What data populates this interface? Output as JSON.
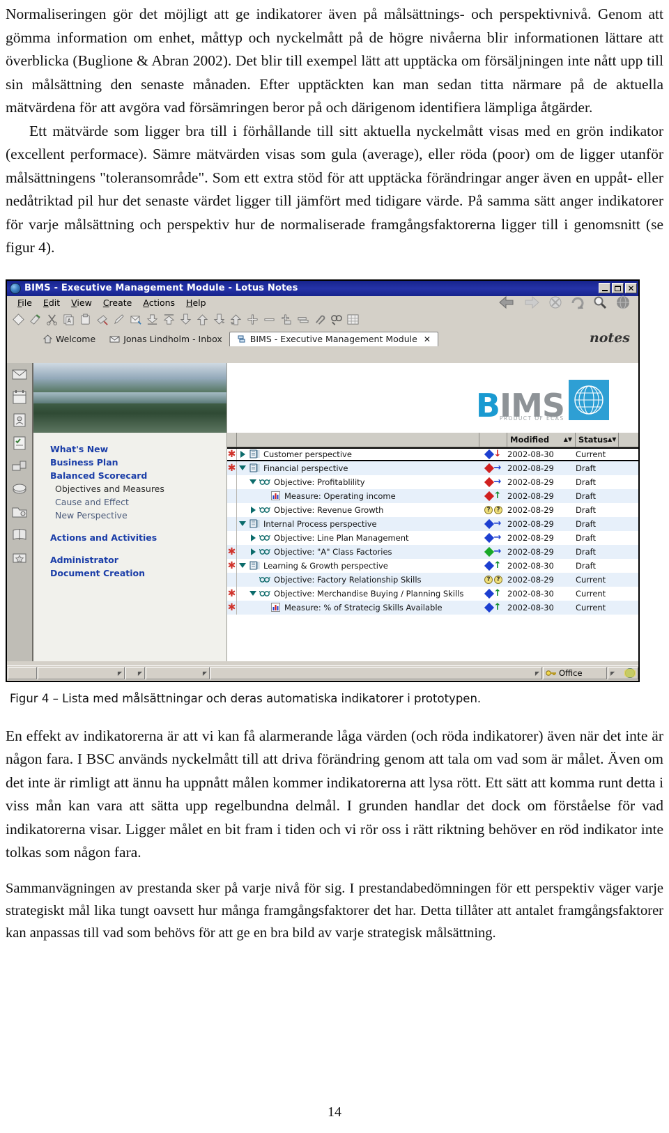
{
  "document": {
    "page_number": "14",
    "paragraph_1": "Normaliseringen gör det möjligt att ge indikatorer även på målsättnings- och perspektivnivå. Genom att gömma information om enhet, måttyp och nyckelmått på de högre nivåerna blir informationen lättare att överblicka (Buglione & Abran 2002). Det blir till exempel lätt att upptäcka om försäljningen inte nått upp till sin målsättning den senaste månaden. Efter upptäckten kan man sedan titta närmare på de aktuella mätvärdena för att avgöra vad försämringen beror på och därigenom identifiera lämpliga åtgärder.",
    "paragraph_2": "Ett mätvärde som ligger bra till i förhållande till sitt aktuella nyckelmått visas med en grön indikator (excellent performace). Sämre mätvärden visas som gula (average), eller röda (poor) om de ligger utanför målsättningens \"toleransområde\". Som ett extra stöd för att upptäcka förändringar anger även en uppåt- eller nedåtriktad pil hur det senaste värdet ligger till jämfört med tidigare värde. På samma sätt anger indikatorer för varje målsättning och perspektiv hur de normaliserade framgångsfaktorerna ligger till i genomsnitt (se figur 4).",
    "figure_caption": "Figur 4 – Lista med målsättningar och deras automatiska indikatorer i prototypen.",
    "paragraph_3": "En effekt av indikatorerna är att vi kan få alarmerande låga värden (och röda indikatorer) även när det inte är någon fara. I BSC används nyckelmått till att driva förändring genom att tala om vad som är målet. Även om det inte är rimligt att ännu ha uppnått målen kommer indikatorerna att lysa rött. Ett sätt att komma runt detta i viss mån kan vara att sätta upp regelbundna delmål. I grunden handlar det dock om förståelse för vad indikatorerna visar. Ligger målet en bit fram i tiden och vi rör oss i rätt riktning behöver en röd indikator inte tolkas som någon fara.",
    "paragraph_4": "Sammanvägningen av prestanda sker på varje nivå för sig. I prestandabedömningen för ett perspektiv väger varje strategiskt mål lika tungt oavsett hur många framgångsfaktorer det har. Detta tillåter att antalet framgångsfaktorer kan anpassas till vad som behövs för att ge en bra bild av varje strategisk målsättning."
  },
  "screenshot": {
    "window": {
      "title": "BIMS - Executive Management Module - Lotus Notes",
      "minimize_label": "Minimize",
      "maximize_label": "Maximize",
      "close_label": "Close"
    },
    "menubar": [
      {
        "label": "File",
        "mnemonic": "F"
      },
      {
        "label": "Edit",
        "mnemonic": "E"
      },
      {
        "label": "View",
        "mnemonic": "V"
      },
      {
        "label": "Create",
        "mnemonic": "C"
      },
      {
        "label": "Actions",
        "mnemonic": "A"
      },
      {
        "label": "Help",
        "mnemonic": "H"
      }
    ],
    "navigation_buttons": [
      {
        "name": "back-icon",
        "label": "Back"
      },
      {
        "name": "forward-icon",
        "label": "Forward"
      },
      {
        "name": "stop-icon",
        "label": "Stop"
      },
      {
        "name": "refresh-icon",
        "label": "Refresh"
      },
      {
        "name": "search-icon",
        "label": "Search"
      },
      {
        "name": "globe-icon",
        "label": "Open Web Page"
      }
    ],
    "toolbar_icons": [
      "new-document-icon",
      "edit-document-icon",
      "cut-icon",
      "copy-icon",
      "paste-icon",
      "delete-icon",
      "edit-pencil-icon",
      "send-mail-icon",
      "move-down-icon",
      "move-up-icon",
      "collapse-icon",
      "expand-icon",
      "collapse-all-icon",
      "expand-all-icon",
      "plus-icon",
      "minus-icon",
      "add-section-icon",
      "link-icon",
      "attach-icon",
      "find-icon",
      "table-icon"
    ],
    "tabs": [
      {
        "label": "Welcome",
        "icon": "home-icon",
        "active": false,
        "closable": false
      },
      {
        "label": "Jonas Lindholm - Inbox",
        "icon": "inbox-icon",
        "active": false,
        "closable": false
      },
      {
        "label": "BIMS - Executive Management Module",
        "icon": "module-icon",
        "active": true,
        "closable": true
      }
    ],
    "notes_wordmark": "notes",
    "icon_sidebar": [
      "mail-icon",
      "calendar-icon",
      "address-book-icon",
      "todo-icon",
      "replication-icon",
      "workspace-icon",
      "folder-icon",
      "bookmark-icon",
      "favorites-icon"
    ],
    "navigator": {
      "items": [
        {
          "label": "What's New",
          "style": "head"
        },
        {
          "label": "Business Plan",
          "style": "head"
        },
        {
          "label": "Balanced Scorecard",
          "style": "head"
        },
        {
          "label": "Objectives and Measures",
          "style": "sub"
        },
        {
          "label": "Cause and Effect",
          "style": "sub-dim"
        },
        {
          "label": "New Perspective",
          "style": "sub-dim"
        },
        {
          "label": "Actions and Activities",
          "style": "head"
        },
        {
          "label": "Administrator",
          "style": "head"
        },
        {
          "label": "Document Creation",
          "style": "head"
        }
      ]
    },
    "brand": {
      "logo_b": "B",
      "logo_rest": "IMS",
      "logo_tagline": "PRODUCT OF ECAS"
    },
    "list": {
      "columns": [
        {
          "key": "gutter",
          "label": "",
          "sortable": false
        },
        {
          "key": "name",
          "label": "",
          "sortable": false
        },
        {
          "key": "indicator",
          "label": "",
          "sortable": false
        },
        {
          "key": "modified",
          "label": "Modified",
          "sortable": true
        },
        {
          "key": "status",
          "label": "Status",
          "sortable": true
        }
      ],
      "rows": [
        {
          "indent": 0,
          "twisty": "right",
          "icon": "perspective-icon",
          "label": "Customer perspective",
          "mark": "",
          "ind_shape": "diamond",
          "ind_color": "#1d3fd0",
          "trend": "down",
          "trend_color": "#d02020",
          "modified": "2002-08-30",
          "status": "Current",
          "selected": true,
          "alt": false
        },
        {
          "indent": 0,
          "twisty": "down",
          "icon": "perspective-icon",
          "label": "Financial perspective",
          "mark": "",
          "ind_shape": "diamond",
          "ind_color": "#d02020",
          "trend": "right",
          "trend_color": "#1d3fd0",
          "modified": "2002-08-29",
          "status": "Draft",
          "selected": false,
          "alt": true
        },
        {
          "indent": 1,
          "twisty": "down",
          "icon": "objective-icon",
          "label": "Objective: Profitablility",
          "mark": "",
          "ind_shape": "diamond",
          "ind_color": "#d02020",
          "trend": "right",
          "trend_color": "#1d3fd0",
          "modified": "2002-08-29",
          "status": "Draft",
          "selected": false,
          "alt": false
        },
        {
          "indent": 2,
          "twisty": "none",
          "icon": "measure-icon",
          "label": "Measure: Operating income",
          "mark": "",
          "ind_shape": "diamond",
          "ind_color": "#d02020",
          "trend": "up",
          "trend_color": "#0a8a28",
          "modified": "2002-08-29",
          "status": "Draft",
          "selected": false,
          "alt": true
        },
        {
          "indent": 1,
          "twisty": "right",
          "icon": "objective-icon",
          "label": "Objective: Revenue Growth",
          "mark": "",
          "ind_shape": "question",
          "ind_color": "#e8d45a",
          "trend": "question",
          "trend_color": "#e8d45a",
          "modified": "2002-08-29",
          "status": "Draft",
          "selected": false,
          "alt": false
        },
        {
          "indent": 0,
          "twisty": "down",
          "icon": "perspective-icon",
          "label": "Internal Process perspective",
          "mark": "",
          "ind_shape": "diamond",
          "ind_color": "#1d3fd0",
          "trend": "right",
          "trend_color": "#1d3fd0",
          "modified": "2002-08-29",
          "status": "Draft",
          "selected": false,
          "alt": true
        },
        {
          "indent": 1,
          "twisty": "right",
          "icon": "objective-icon",
          "label": "Objective: Line Plan Management",
          "mark": "",
          "ind_shape": "diamond",
          "ind_color": "#1d3fd0",
          "trend": "right",
          "trend_color": "#1d3fd0",
          "modified": "2002-08-29",
          "status": "Draft",
          "selected": false,
          "alt": false
        },
        {
          "indent": 1,
          "twisty": "right",
          "icon": "objective-icon",
          "label": "Objective: \"A\" Class Factories",
          "mark": "*",
          "ind_shape": "diamond",
          "ind_color": "#18a828",
          "trend": "right",
          "trend_color": "#1d3fd0",
          "modified": "2002-08-29",
          "status": "Draft",
          "selected": false,
          "alt": true
        },
        {
          "indent": 0,
          "twisty": "down",
          "icon": "perspective-icon",
          "label": "Learning & Growth perspective",
          "mark": "*",
          "ind_shape": "diamond",
          "ind_color": "#1d3fd0",
          "trend": "up",
          "trend_color": "#0a8a28",
          "modified": "2002-08-30",
          "status": "Draft",
          "selected": false,
          "alt": false
        },
        {
          "indent": 1,
          "twisty": "none",
          "icon": "objective-icon",
          "label": "Objective: Factory Relationship Skills",
          "mark": "",
          "ind_shape": "question",
          "ind_color": "#e8d45a",
          "trend": "question",
          "trend_color": "#e8d45a",
          "modified": "2002-08-29",
          "status": "Current",
          "selected": false,
          "alt": true
        },
        {
          "indent": 1,
          "twisty": "down",
          "icon": "objective-icon",
          "label": "Objective: Merchandise Buying / Planning Skills",
          "mark": "*",
          "ind_shape": "diamond",
          "ind_color": "#1d3fd0",
          "trend": "up",
          "trend_color": "#0a8a28",
          "modified": "2002-08-30",
          "status": "Current",
          "selected": false,
          "alt": false
        },
        {
          "indent": 2,
          "twisty": "none",
          "icon": "measure-icon",
          "label": "Measure: % of Stratecig Skills Available",
          "mark": "*",
          "ind_shape": "diamond",
          "ind_color": "#1d3fd0",
          "trend": "up",
          "trend_color": "#0a8a28",
          "modified": "2002-08-30",
          "status": "Current",
          "selected": false,
          "alt": true
        }
      ],
      "gutter_marks": [
        {
          "row": 0,
          "mark": "*"
        },
        {
          "row": 1,
          "mark": "*"
        },
        {
          "row": 7,
          "mark": "*"
        },
        {
          "row": 8,
          "mark": "*"
        },
        {
          "row": 10,
          "mark": "*"
        },
        {
          "row": 11,
          "mark": "*"
        }
      ]
    },
    "statusbar": {
      "location_label": "Office",
      "key_icon": "key-icon",
      "globe_icon": "globe-icon"
    },
    "colors": {
      "titlebar": "#16238c",
      "chrome": "#d4d0c8",
      "nav_heading": "#1b3ea8",
      "row_alt": "#e7f0fa",
      "indicator_green": "#18a828",
      "indicator_red": "#d02020",
      "indicator_blue": "#1d3fd0",
      "indicator_yellow": "#e8d45a",
      "brand_blue": "#1a9ad1",
      "gutter_mark": "#d0342c"
    }
  }
}
